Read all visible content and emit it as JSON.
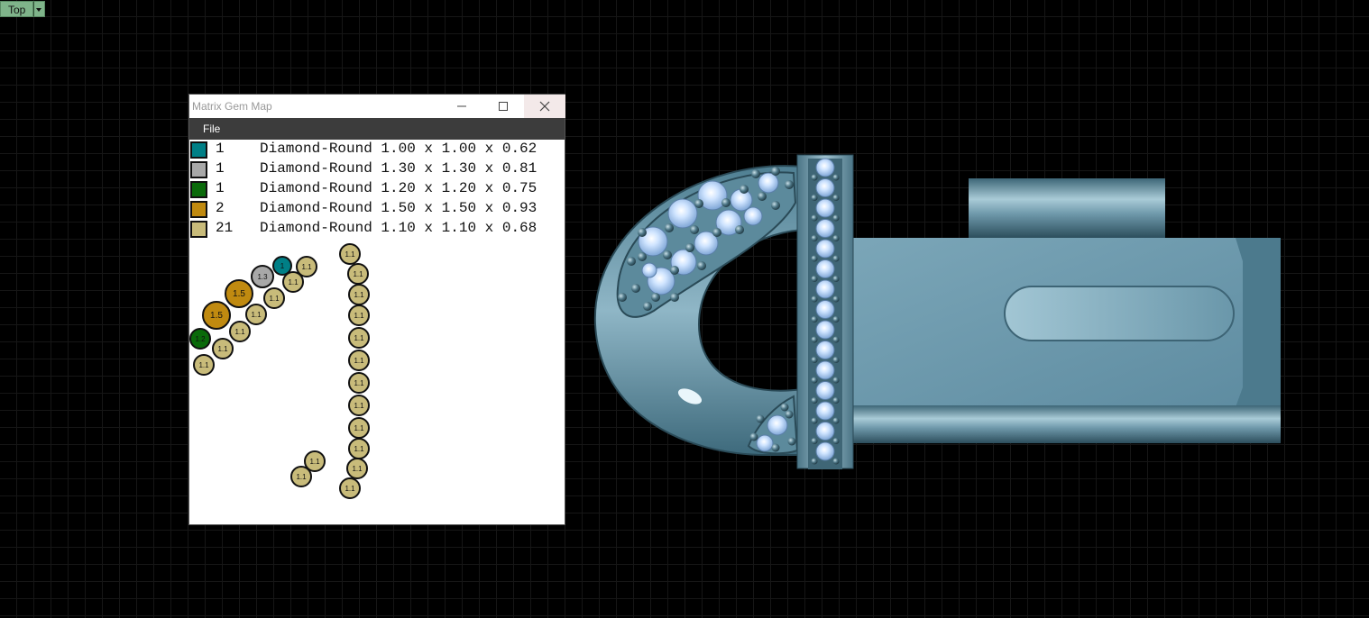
{
  "viewport": {
    "view_label": "Top"
  },
  "gem_window": {
    "title": "Matrix Gem Map",
    "menu": {
      "file": "File"
    },
    "rows": [
      {
        "count": "1",
        "description": "Diamond-Round 1.00 x 1.00 x 0.62",
        "color": "#007f86"
      },
      {
        "count": "1",
        "description": "Diamond-Round 1.30 x 1.30 x 0.81",
        "color": "#a8a8a8"
      },
      {
        "count": "1",
        "description": "Diamond-Round 1.20 x 1.20 x 0.75",
        "color": "#0a6a0a"
      },
      {
        "count": "2",
        "description": "Diamond-Round 1.50 x 1.50 x 0.93",
        "color": "#c08a10"
      },
      {
        "count": "21",
        "description": "Diamond-Round 1.10 x 1.10 x 0.68",
        "color": "#c8bb7a"
      }
    ],
    "map_labels": {
      "s100": "1",
      "s110": "1.1",
      "s120": "1.2",
      "s130": "1.3",
      "s150": "1.5"
    }
  },
  "colors": {
    "metal": "#5f8ea2",
    "gem": "#b9d7ff",
    "prong": "#3a5a66"
  }
}
